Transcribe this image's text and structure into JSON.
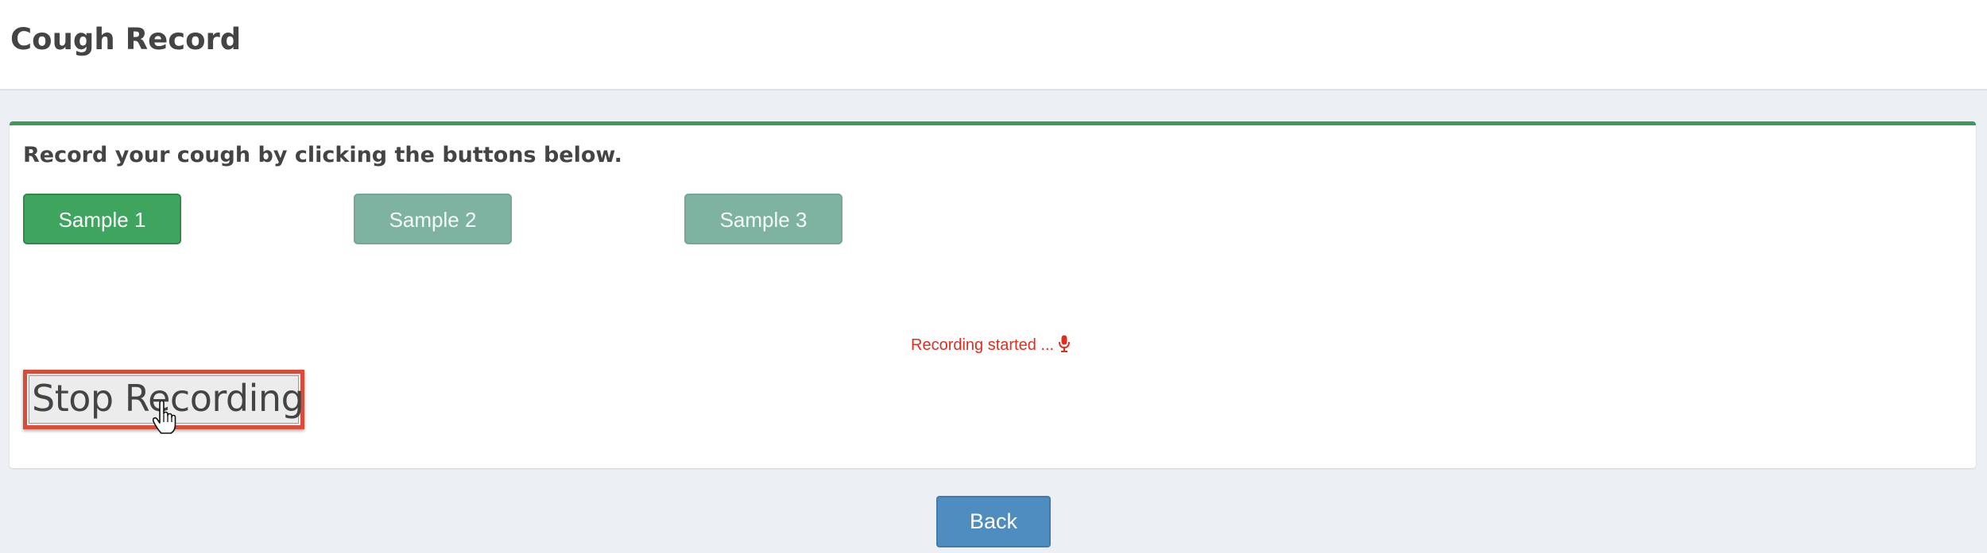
{
  "header": {
    "title": "Cough Record"
  },
  "recorder": {
    "instruction": "Record your cough by clicking the buttons below.",
    "samples": [
      {
        "label": "Sample 1",
        "state": "active"
      },
      {
        "label": "Sample 2",
        "state": "disabled"
      },
      {
        "label": "Sample 3",
        "state": "disabled"
      }
    ],
    "status_text": "Recording started ...",
    "status_icon": "microphone-icon",
    "stop_label": "Stop Recording"
  },
  "footer": {
    "back_label": "Back"
  },
  "colors": {
    "accent_green": "#3c9a5c",
    "sample_active": "#3fa55e",
    "sample_disabled": "#7fb3a1",
    "status_red": "#dd2e1f",
    "stop_border": "#d64d3a",
    "back_blue": "#4f8dc1",
    "page_background": "#ecf0f5"
  },
  "cursor": {
    "icon": "hand-pointer-icon"
  }
}
